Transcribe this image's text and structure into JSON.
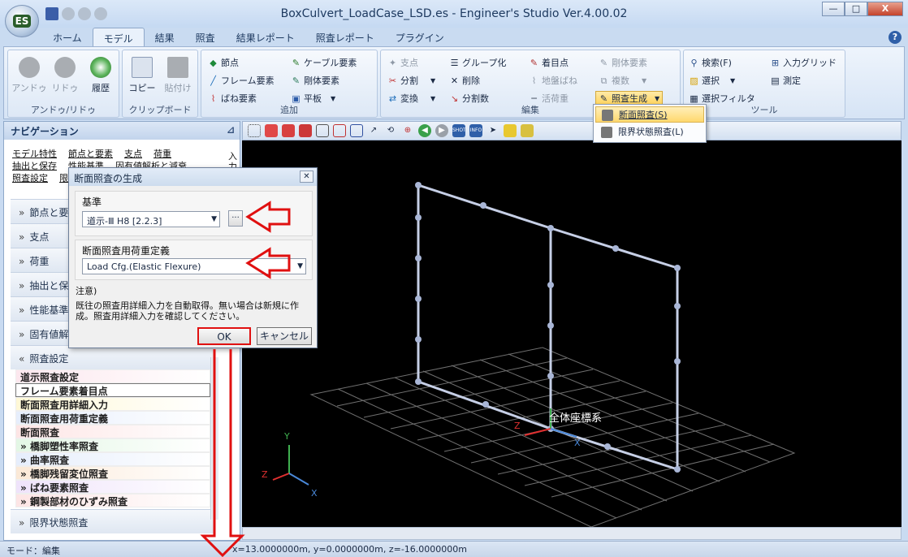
{
  "app": {
    "title": "BoxCulvert_LoadCase_LSD.es - Engineer's Studio Ver.4.00.02",
    "logo_text": "ES",
    "window_controls": [
      "—",
      "□",
      "X"
    ]
  },
  "ribbon_tabs": [
    "ホーム",
    "モデル",
    "結果",
    "照査",
    "結果レポート",
    "照査レポート",
    "プラグイン"
  ],
  "active_tab": "モデル",
  "ribbon": {
    "undo": {
      "undo": "アンドゥ",
      "redo": "リドゥ",
      "history": "履歴",
      "group": "アンドゥ/リドゥ"
    },
    "clipboard": {
      "copy": "コピー",
      "paste": "貼付け",
      "group": "クリップボード"
    },
    "add": {
      "items": [
        "節点",
        "ケーブル要素",
        "フレーム要素",
        "剛体要素",
        "ばね要素",
        "平板"
      ],
      "group": "追加"
    },
    "edit": {
      "items": [
        "支点",
        "グループ化",
        "着目点",
        "剛体要素",
        "分割",
        "削除",
        "地盤ばね",
        "複数",
        "変換",
        "分割数",
        "活荷重",
        "照査生成"
      ],
      "group": "編集"
    },
    "tool": {
      "items": [
        "検索(F)",
        "入力グリッド",
        "選択",
        "測定",
        "選択フィルタ"
      ],
      "group": "ツール"
    }
  },
  "dropdown": {
    "items": [
      "断面照査(S)",
      "限界状態照査(L)"
    ]
  },
  "navigation": {
    "title": "ナビゲーション",
    "pin": "⊿",
    "links": [
      [
        "モデル特性",
        "節点と要素",
        "支点",
        "荷重"
      ],
      [
        "抽出と保存",
        "性能基準",
        "固有値解析と減衰"
      ],
      [
        "照査設定",
        "限"
      ]
    ],
    "side_text": "入力",
    "sections": [
      "節点と要素",
      "支点",
      "荷重",
      "抽出と保存",
      "性能基準",
      "固有値解",
      "照査設定"
    ],
    "items": [
      "道示照査設定",
      "フレーム要素着目点",
      "断面照査用詳細入力",
      "断面照査用荷重定義",
      "断面照査",
      "橋脚塑性率照査",
      "曲率照査",
      "橋脚残留変位照査",
      "ばね要素照査",
      "鋼製部材のひずみ照査"
    ],
    "bottom_section": "限界状態照査"
  },
  "dialog": {
    "title": "断面照査の生成",
    "criteria_label": "基準",
    "criteria_value": "道示-Ⅲ H8 [2.2.3]",
    "ellipsis": "...",
    "load_label": "断面照査用荷重定義",
    "load_value": "Load Cfg.(Elastic Flexure)",
    "note_label": "注意)",
    "note_text": "既往の照査用詳細入力を自動取得。無い場合は新規に作成。照査用詳細入力を確認してください。",
    "ok": "OK",
    "cancel": "キャンセル"
  },
  "viewport": {
    "coord_label": "全体座標系",
    "axis_x": "X",
    "axis_y": "Y",
    "axis_z": "Z"
  },
  "status": {
    "mode": "モード：編集",
    "coords": "x=13.0000000m, y=0.0000000m, z=-16.0000000m"
  },
  "colors": {
    "annotation": "#e01010",
    "frame": "#c6cfe6",
    "grid": "#6f6f6f",
    "axis_x": "#4a88d8",
    "axis_y": "#3fb050",
    "axis_z": "#e03030"
  }
}
